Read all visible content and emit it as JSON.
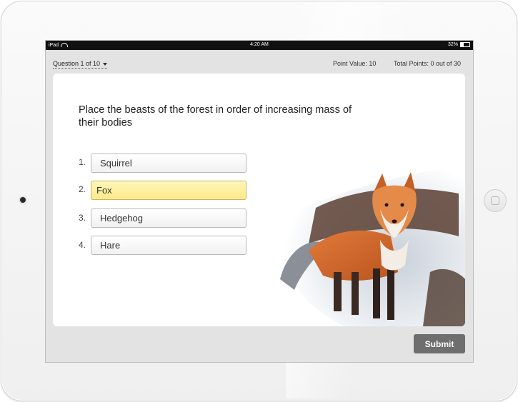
{
  "status_bar": {
    "device": "iPad",
    "time": "4:20 AM",
    "battery": "32%",
    "battery_level": 0.32
  },
  "header": {
    "question_selector": "Question 1 of 10",
    "point_value": "Point Value: 10",
    "total_points": "Total Points: 0 out of 30"
  },
  "question": {
    "text": "Place the beasts of the forest in order of increasing mass of their bodies"
  },
  "options": [
    {
      "number": "1.",
      "label": "Squirrel"
    },
    {
      "number": "2.",
      "label": "Fox"
    },
    {
      "number": "3.",
      "label": "Hedgehog"
    },
    {
      "number": "4.",
      "label": "Hare"
    }
  ],
  "selected_option": "Fox",
  "submit_label": "Submit",
  "colors": {
    "selected_option": "#fde98a",
    "submit_button": "#6e6e6e",
    "screen_bg": "#e3e3e3"
  }
}
